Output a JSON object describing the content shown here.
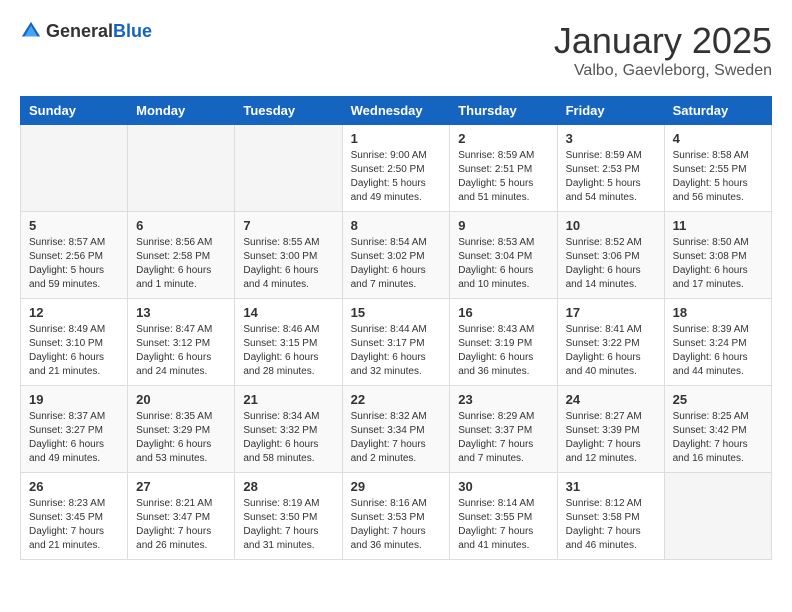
{
  "logo": {
    "general": "General",
    "blue": "Blue"
  },
  "header": {
    "month": "January 2025",
    "location": "Valbo, Gaevleborg, Sweden"
  },
  "weekdays": [
    "Sunday",
    "Monday",
    "Tuesday",
    "Wednesday",
    "Thursday",
    "Friday",
    "Saturday"
  ],
  "weeks": [
    [
      {
        "day": "",
        "info": ""
      },
      {
        "day": "",
        "info": ""
      },
      {
        "day": "",
        "info": ""
      },
      {
        "day": "1",
        "info": "Sunrise: 9:00 AM\nSunset: 2:50 PM\nDaylight: 5 hours\nand 49 minutes."
      },
      {
        "day": "2",
        "info": "Sunrise: 8:59 AM\nSunset: 2:51 PM\nDaylight: 5 hours\nand 51 minutes."
      },
      {
        "day": "3",
        "info": "Sunrise: 8:59 AM\nSunset: 2:53 PM\nDaylight: 5 hours\nand 54 minutes."
      },
      {
        "day": "4",
        "info": "Sunrise: 8:58 AM\nSunset: 2:55 PM\nDaylight: 5 hours\nand 56 minutes."
      }
    ],
    [
      {
        "day": "5",
        "info": "Sunrise: 8:57 AM\nSunset: 2:56 PM\nDaylight: 5 hours\nand 59 minutes."
      },
      {
        "day": "6",
        "info": "Sunrise: 8:56 AM\nSunset: 2:58 PM\nDaylight: 6 hours\nand 1 minute."
      },
      {
        "day": "7",
        "info": "Sunrise: 8:55 AM\nSunset: 3:00 PM\nDaylight: 6 hours\nand 4 minutes."
      },
      {
        "day": "8",
        "info": "Sunrise: 8:54 AM\nSunset: 3:02 PM\nDaylight: 6 hours\nand 7 minutes."
      },
      {
        "day": "9",
        "info": "Sunrise: 8:53 AM\nSunset: 3:04 PM\nDaylight: 6 hours\nand 10 minutes."
      },
      {
        "day": "10",
        "info": "Sunrise: 8:52 AM\nSunset: 3:06 PM\nDaylight: 6 hours\nand 14 minutes."
      },
      {
        "day": "11",
        "info": "Sunrise: 8:50 AM\nSunset: 3:08 PM\nDaylight: 6 hours\nand 17 minutes."
      }
    ],
    [
      {
        "day": "12",
        "info": "Sunrise: 8:49 AM\nSunset: 3:10 PM\nDaylight: 6 hours\nand 21 minutes."
      },
      {
        "day": "13",
        "info": "Sunrise: 8:47 AM\nSunset: 3:12 PM\nDaylight: 6 hours\nand 24 minutes."
      },
      {
        "day": "14",
        "info": "Sunrise: 8:46 AM\nSunset: 3:15 PM\nDaylight: 6 hours\nand 28 minutes."
      },
      {
        "day": "15",
        "info": "Sunrise: 8:44 AM\nSunset: 3:17 PM\nDaylight: 6 hours\nand 32 minutes."
      },
      {
        "day": "16",
        "info": "Sunrise: 8:43 AM\nSunset: 3:19 PM\nDaylight: 6 hours\nand 36 minutes."
      },
      {
        "day": "17",
        "info": "Sunrise: 8:41 AM\nSunset: 3:22 PM\nDaylight: 6 hours\nand 40 minutes."
      },
      {
        "day": "18",
        "info": "Sunrise: 8:39 AM\nSunset: 3:24 PM\nDaylight: 6 hours\nand 44 minutes."
      }
    ],
    [
      {
        "day": "19",
        "info": "Sunrise: 8:37 AM\nSunset: 3:27 PM\nDaylight: 6 hours\nand 49 minutes."
      },
      {
        "day": "20",
        "info": "Sunrise: 8:35 AM\nSunset: 3:29 PM\nDaylight: 6 hours\nand 53 minutes."
      },
      {
        "day": "21",
        "info": "Sunrise: 8:34 AM\nSunset: 3:32 PM\nDaylight: 6 hours\nand 58 minutes."
      },
      {
        "day": "22",
        "info": "Sunrise: 8:32 AM\nSunset: 3:34 PM\nDaylight: 7 hours\nand 2 minutes."
      },
      {
        "day": "23",
        "info": "Sunrise: 8:29 AM\nSunset: 3:37 PM\nDaylight: 7 hours\nand 7 minutes."
      },
      {
        "day": "24",
        "info": "Sunrise: 8:27 AM\nSunset: 3:39 PM\nDaylight: 7 hours\nand 12 minutes."
      },
      {
        "day": "25",
        "info": "Sunrise: 8:25 AM\nSunset: 3:42 PM\nDaylight: 7 hours\nand 16 minutes."
      }
    ],
    [
      {
        "day": "26",
        "info": "Sunrise: 8:23 AM\nSunset: 3:45 PM\nDaylight: 7 hours\nand 21 minutes."
      },
      {
        "day": "27",
        "info": "Sunrise: 8:21 AM\nSunset: 3:47 PM\nDaylight: 7 hours\nand 26 minutes."
      },
      {
        "day": "28",
        "info": "Sunrise: 8:19 AM\nSunset: 3:50 PM\nDaylight: 7 hours\nand 31 minutes."
      },
      {
        "day": "29",
        "info": "Sunrise: 8:16 AM\nSunset: 3:53 PM\nDaylight: 7 hours\nand 36 minutes."
      },
      {
        "day": "30",
        "info": "Sunrise: 8:14 AM\nSunset: 3:55 PM\nDaylight: 7 hours\nand 41 minutes."
      },
      {
        "day": "31",
        "info": "Sunrise: 8:12 AM\nSunset: 3:58 PM\nDaylight: 7 hours\nand 46 minutes."
      },
      {
        "day": "",
        "info": ""
      }
    ]
  ]
}
